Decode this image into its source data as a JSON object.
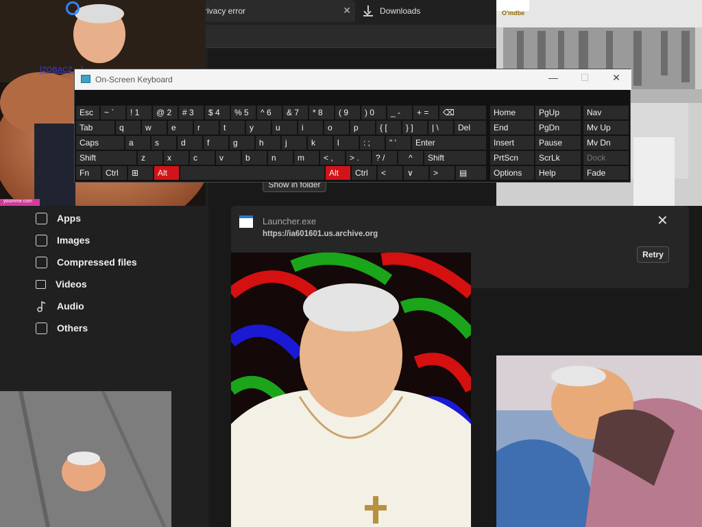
{
  "browser": {
    "active_tab_title": "rivacy error",
    "downloads_tab_title": "Downloads",
    "close_glyph": "✕"
  },
  "sidebar": {
    "items": [
      {
        "label": "Apps",
        "icon": "apps-icon"
      },
      {
        "label": "Images",
        "icon": "images-icon"
      },
      {
        "label": "Compressed files",
        "icon": "compressed-files-icon"
      },
      {
        "label": "Videos",
        "icon": "videos-icon"
      },
      {
        "label": "Audio",
        "icon": "audio-icon"
      },
      {
        "label": "Others",
        "icon": "others-icon"
      }
    ]
  },
  "download": {
    "show_in_folder": "Show in folder",
    "file_name": "Launcher.exe",
    "url": "https://ia601601.us.archive.org",
    "retry": "Retry",
    "close_glyph": "✕"
  },
  "osk": {
    "title": "On-Screen Keyboard",
    "minimize": "—",
    "maximize": "☐",
    "close": "✕",
    "rows": [
      [
        "Esc",
        "~ `",
        "! 1",
        "@ 2",
        "# 3",
        "$ 4",
        "% 5",
        "^ 6",
        "& 7",
        "* 8",
        "( 9",
        ") 0",
        "_ -",
        "+ =",
        "⌫"
      ],
      [
        "Tab",
        "q",
        "w",
        "e",
        "r",
        "t",
        "y",
        "u",
        "i",
        "o",
        "p",
        "{ [",
        "} ]",
        "| \\",
        "Del"
      ],
      [
        "Caps",
        "a",
        "s",
        "d",
        "f",
        "g",
        "h",
        "j",
        "k",
        "l",
        ": ;",
        "\" '",
        "Enter"
      ],
      [
        "Shift",
        "z",
        "x",
        "c",
        "v",
        "b",
        "n",
        "m",
        "< ,",
        "> .",
        "? /",
        "^",
        "Shift"
      ],
      [
        "Fn",
        "Ctrl",
        "⊞",
        "Alt",
        "",
        "Alt",
        "Ctrl",
        "<",
        "∨",
        ">",
        "▤"
      ]
    ],
    "nav": [
      [
        "Home",
        "PgUp",
        "Nav"
      ],
      [
        "End",
        "PgDn",
        "Mv Up"
      ],
      [
        "Insert",
        "Pause",
        "Mv Dn"
      ],
      [
        "PrtScn",
        "ScrLk",
        "Dock"
      ],
      [
        "Options",
        "Help",
        "Fade"
      ]
    ]
  },
  "overlays": {
    "top_left_link": "[ZOBACZ ...]",
    "top_left_watermark": "youmme.com",
    "top_right_sign": "O'mdbe"
  },
  "colors": {
    "alt_key": "#d0141a",
    "accent_link": "#3a3aff"
  }
}
